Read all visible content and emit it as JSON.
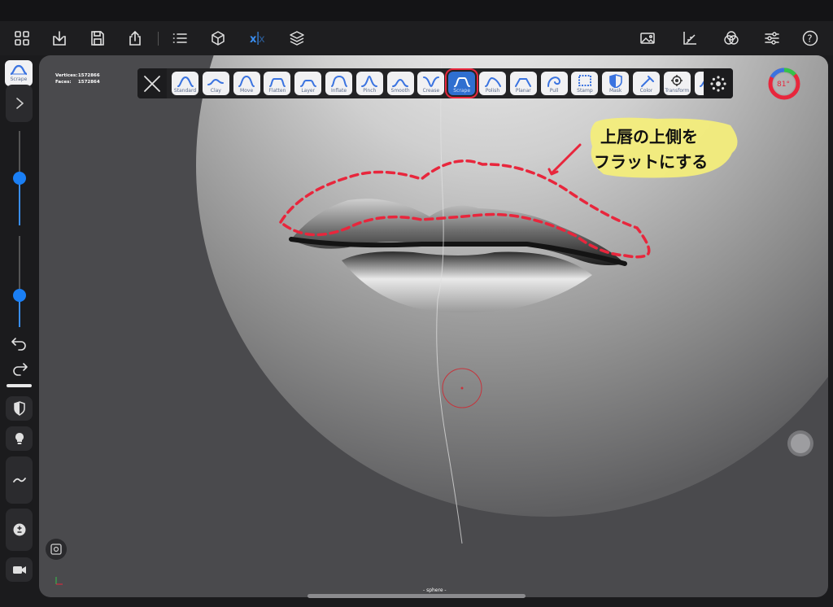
{
  "toolbar": {
    "left_icons": [
      "grid-icon",
      "import-icon",
      "save-icon",
      "share-icon",
      "list-icon",
      "cube-icon",
      "symmetry-icon",
      "layers-icon"
    ],
    "right_icons": [
      "image-icon",
      "ruler-icon",
      "materials-icon",
      "sliders-icon",
      "help-icon"
    ]
  },
  "stats": {
    "vertices_label": "Vertices:",
    "vertices": "1572866",
    "faces_label": "Faces:",
    "faces": "1572864"
  },
  "brushes": [
    {
      "label": "Standard"
    },
    {
      "label": "Clay"
    },
    {
      "label": "Move"
    },
    {
      "label": "Flatten"
    },
    {
      "label": "Layer"
    },
    {
      "label": "Inflate"
    },
    {
      "label": "Pinch"
    },
    {
      "label": "Smooth"
    },
    {
      "label": "Crease"
    },
    {
      "label": "Scrape",
      "active": true
    },
    {
      "label": "Polish"
    },
    {
      "label": "Planar"
    },
    {
      "label": "Pull"
    },
    {
      "label": "Stamp"
    },
    {
      "label": "Mask"
    },
    {
      "label": "Color"
    },
    {
      "label": "Transform"
    },
    {
      "label": "C"
    }
  ],
  "sidebar": {
    "current_tool": "Scrape",
    "radius_percent": 50,
    "intensity_percent": 35
  },
  "gauge": {
    "value": "81°",
    "colors": [
      "#e8263c",
      "#3a73e0",
      "#35c24a",
      "#f2c230"
    ]
  },
  "annotation": {
    "line1": "上唇の上側を",
    "line2": "フラットにする",
    "accent": "#e8263c",
    "highlight": "#f5ef7a"
  },
  "scene_name": "- sphere -"
}
